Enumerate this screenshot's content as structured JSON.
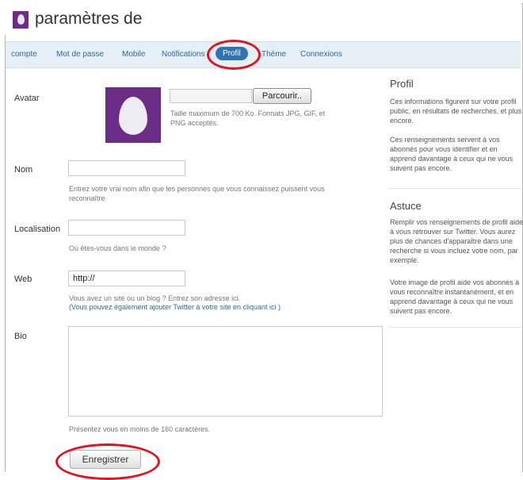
{
  "header": {
    "title": "paramètres de"
  },
  "tabs": [
    {
      "label": "compte"
    },
    {
      "label": "Mot de passe"
    },
    {
      "label": "Mobile"
    },
    {
      "label": "Notifications"
    },
    {
      "label": "Profil"
    },
    {
      "label": "Thème"
    },
    {
      "label": "Connexions"
    }
  ],
  "active_tab": "Profil",
  "form": {
    "avatar": {
      "label": "Avatar",
      "browse_label": "Parcourir..",
      "hint": "Taille maximum de 700 Ko. Formats JPG, GIF, et PNG acceptés."
    },
    "nom": {
      "label": "Nom",
      "value": "",
      "hint": "Entrez votre vrai nom afin que les personnes que vous connaissez puissent vous reconnaître"
    },
    "localisation": {
      "label": "Localisation",
      "value": "",
      "hint": "Où êtes-vous dans le monde ?"
    },
    "web": {
      "label": "Web",
      "value": "http://",
      "hint": "Vous avez un site ou un blog ? Entrez son adresse ici.",
      "link": "(Vous pouvez également ajouter Twitter à votre site en cliquant ici )"
    },
    "bio": {
      "label": "Bio",
      "value": "",
      "hint": "Présentez vous en moins de 160 caractères."
    },
    "save_label": "Enregistrer"
  },
  "sidebar": {
    "profil": {
      "title": "Profil",
      "p1": "Ces informations figurent sur votre profil public, en résultats de recherches, et plus encore.",
      "p2": "Ces renseignements servent à vos abonnés pour vous identifier et en apprend davantage à ceux qui ne vous suivent pas encore."
    },
    "astuce": {
      "title": "Astuce",
      "p1": "Remplir vos renseignements de profil aide à vous retrouver sur Twitter. Vous aurez plus de chances d'apparaître dans une recherche si vous incluez votre nom, par exemple.",
      "p2": "Votre image de profil aide vos abonnés à vous reconnaître instantanément, et en apprend davantage à ceux qui ne vous suivent pas encore."
    }
  },
  "colors": {
    "accent": "#2e74b5",
    "highlight_ring": "#e0141e",
    "avatar_bg": "#6b2d86",
    "tabbar_bg": "#e6eff6"
  },
  "icons": {
    "avatar": "egg-avatar-icon"
  }
}
